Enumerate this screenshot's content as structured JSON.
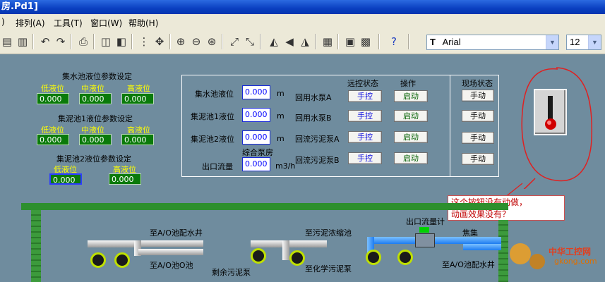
{
  "window": {
    "title": "房.Pd1]"
  },
  "menu": [
    {
      "label": ")"
    },
    {
      "label": "排列(A)"
    },
    {
      "label": "工具(T)"
    },
    {
      "label": "窗口(W)"
    },
    {
      "label": "帮助(H)"
    }
  ],
  "toolbar": {
    "font_name": "Arial",
    "font_size": "12",
    "font_prefix": "T"
  },
  "sump": {
    "title": "集水池液位参数设定",
    "labels": [
      "低液位",
      "中液位",
      "高液位"
    ],
    "values": [
      "0.000",
      "0.000",
      "0.000"
    ]
  },
  "sludge1": {
    "title": "集泥池1液位参数设定",
    "labels": [
      "低液位",
      "中液位",
      "高液位"
    ],
    "values": [
      "0.000",
      "0.000",
      "0.000"
    ]
  },
  "sludge2": {
    "title": "集泥池2液位参数设定",
    "labels": [
      "低液位",
      "高液位"
    ],
    "values": [
      "0.000",
      "0.000"
    ]
  },
  "control": {
    "headers": {
      "remote": "远控状态",
      "operate": "操作",
      "field": "现场状态"
    },
    "rows": [
      {
        "label": "集水池液位",
        "value": "0.000",
        "unit": "m",
        "pump": "回用水泵A",
        "remote": "手控",
        "op": "启动",
        "field": "手动"
      },
      {
        "label": "集泥池1液位",
        "value": "0.000",
        "unit": "m",
        "pump": "回用水泵B",
        "remote": "手控",
        "op": "启动",
        "field": "手动"
      },
      {
        "label": "集泥池2液位",
        "value": "0.000",
        "unit": "m",
        "pump": "回流污泥泵A",
        "remote": "手控",
        "op": "启动",
        "field": "手动"
      },
      {
        "label": "出口流量",
        "value": "0.000",
        "unit": "m3/h",
        "pump": "回流污泥泵B",
        "remote": "手控",
        "op": "启动",
        "field": "手动"
      }
    ],
    "pump_house": "综合泵房"
  },
  "callout": {
    "line1": "这个按钮没有动做，",
    "line2": "动画效果没有？"
  },
  "diagram": {
    "labels": {
      "to_ao_well": "至A/O池配水井",
      "to_ao_o": "至A/O池O池",
      "to_thickener": "至污泥浓缩池",
      "to_chem": "至化学污泥泵",
      "remain": "剩余污泥泵",
      "outlet_meter": "出口流量计",
      "focus": "焦集",
      "to_ao_well_2": "至A/O池配水井"
    }
  },
  "watermark": {
    "cn": "中华工控网",
    "url": "gkong.com"
  },
  "colors": {
    "panel_bg": "#6f8c9e",
    "value_box": "#0a7a0a",
    "label_yellow": "#ffff00",
    "pipe_blue": "#1e7cf0"
  }
}
